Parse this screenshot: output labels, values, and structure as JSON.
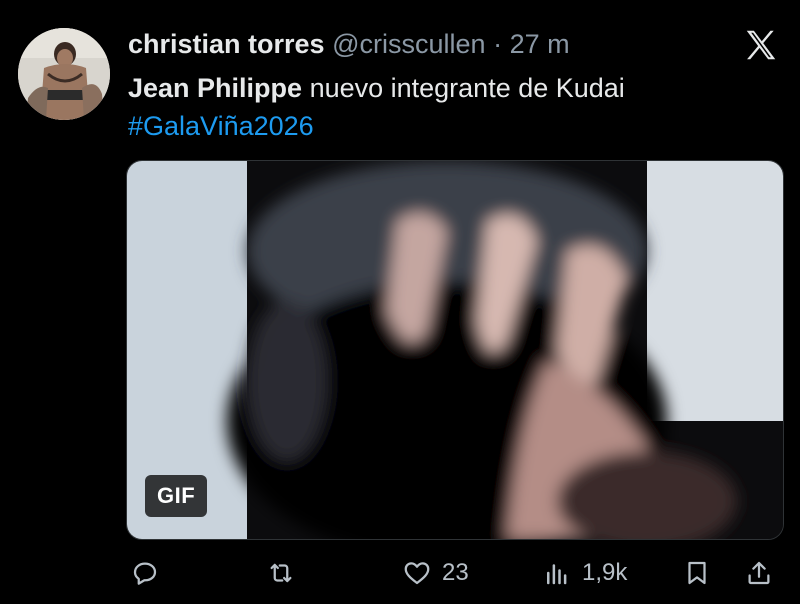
{
  "tweet": {
    "author_name": "christian torres",
    "handle": "@crisscullen",
    "separator": "·",
    "time": "27 m",
    "mention": "Jean Philippe",
    "text": " nuevo integrante de Kudai",
    "hashtag": "#GalaViña2026"
  },
  "media": {
    "badge": "GIF"
  },
  "actions": {
    "reply_count": "",
    "retweet_count": "",
    "like_count": "23",
    "views_count": "1,9k"
  },
  "icons": {
    "brand": "x-logo-icon",
    "reply": "reply-icon",
    "retweet": "retweet-icon",
    "like": "heart-icon",
    "views": "views-icon",
    "bookmark": "bookmark-icon",
    "share": "share-icon"
  },
  "colors": {
    "background": "#000000",
    "text": "#e7e9ea",
    "muted": "#8b98a5",
    "link": "#1d9bf0"
  }
}
